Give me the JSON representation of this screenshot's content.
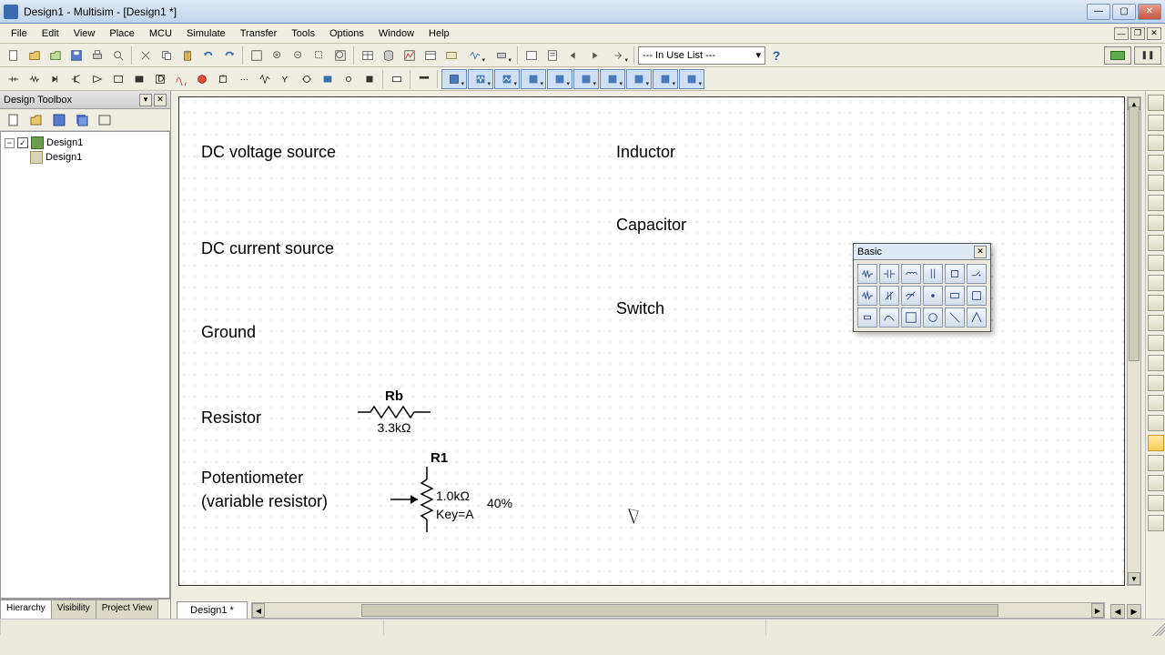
{
  "window": {
    "title": "Design1 - Multisim - [Design1 *]"
  },
  "menu": {
    "items": [
      "File",
      "Edit",
      "View",
      "Place",
      "MCU",
      "Simulate",
      "Transfer",
      "Tools",
      "Options",
      "Window",
      "Help"
    ]
  },
  "toolbar1": {
    "in_use_list": "--- In Use List ---"
  },
  "design_toolbox": {
    "title": "Design Toolbox",
    "root": "Design1",
    "child": "Design1",
    "tabs": [
      "Hierarchy",
      "Visibility",
      "Project View"
    ],
    "active_tab": 0
  },
  "canvas": {
    "labels": {
      "dc_voltage": "DC voltage source",
      "dc_current": "DC current source",
      "ground": "Ground",
      "resistor": "Resistor",
      "potentiometer_l1": "Potentiometer",
      "potentiometer_l2": "(variable resistor)",
      "inductor": "Inductor",
      "capacitor": "Capacitor",
      "switch": "Switch"
    },
    "resistor": {
      "name": "Rb",
      "value": "3.3kΩ"
    },
    "pot": {
      "name": "R1",
      "value": "1.0kΩ",
      "key": "Key=A",
      "pct": "40%"
    }
  },
  "float_palette": {
    "title": "Basic"
  },
  "doc_tab": "Design1 *"
}
